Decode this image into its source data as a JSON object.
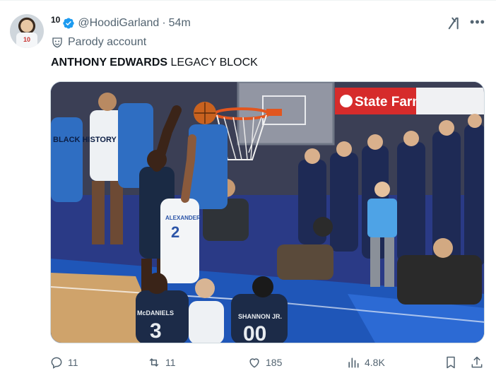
{
  "tweet": {
    "display_name": "10",
    "handle": "@HoodiGarland",
    "separator": "·",
    "time": "54m",
    "parody_label": "Parody account",
    "text_bold": "ANTHONY EDWARDS",
    "text_rest": " LEGACY BLOCK"
  },
  "avatar": {
    "jersey_number": "10"
  },
  "media": {
    "banner_text": "State Farm",
    "jerseys": [
      {
        "name": "McDANIELS",
        "number": "3"
      },
      {
        "name": "SHANNON JR.",
        "number": "00"
      },
      {
        "name": "ALEXANDER",
        "number": "2"
      }
    ],
    "fan_shirt_text": "BLACK HISTORY"
  },
  "actions": {
    "replies": "11",
    "reposts": "11",
    "likes": "185",
    "views": "4.8K"
  },
  "icons": [
    "verified-icon",
    "grok-icon",
    "more-icon",
    "parody-mask-icon",
    "reply-icon",
    "repost-icon",
    "like-icon",
    "views-icon",
    "bookmark-icon",
    "share-icon"
  ],
  "colors": {
    "verified": "#1d9bf0",
    "secondary_text": "#536471",
    "court_blue": "#1f56b8"
  }
}
